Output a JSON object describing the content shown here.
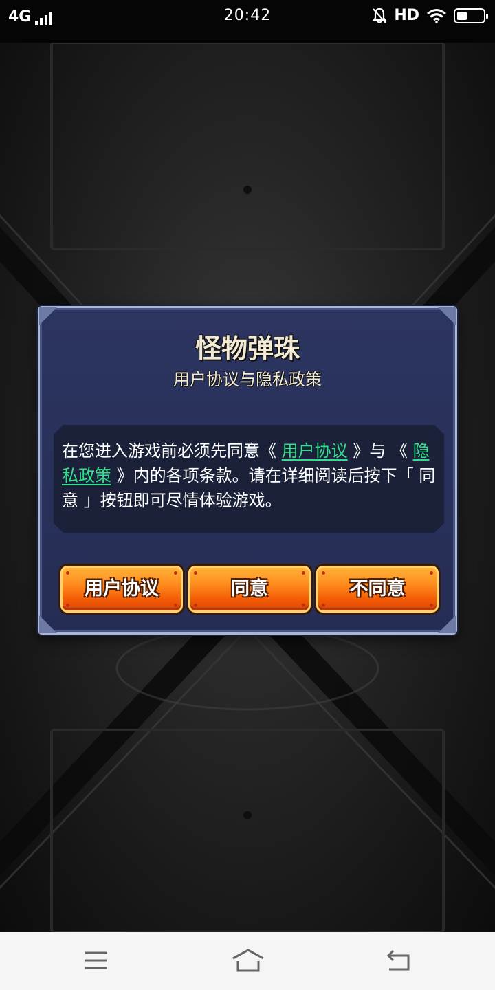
{
  "status_bar": {
    "network": "4G",
    "time": "20:42",
    "hd_label": "HD"
  },
  "dialog": {
    "title": "怪物弹珠",
    "subtitle": "用户协议与隐私政策",
    "body": {
      "text_1": "在您进入游戏前必须先同意《",
      "link_user_agreement": "用户协议",
      "text_2": "》与",
      "text_3": "《",
      "link_privacy_policy": "隐私政策",
      "text_4": "》内的各项条款。请在详细阅读后按下「 同意 」按钮即可尽情体验游戏。"
    },
    "buttons": {
      "user_agreement": "用户协议",
      "agree": "同意",
      "disagree": "不同意"
    }
  },
  "colors": {
    "dialog_bg": "#2c3560",
    "link": "#2fe08a",
    "button": "#ff8a1c"
  },
  "icons": [
    "no-sound-bell-icon",
    "wifi-icon",
    "battery-icon",
    "signal-icon",
    "menu-icon",
    "home-icon",
    "back-icon"
  ]
}
